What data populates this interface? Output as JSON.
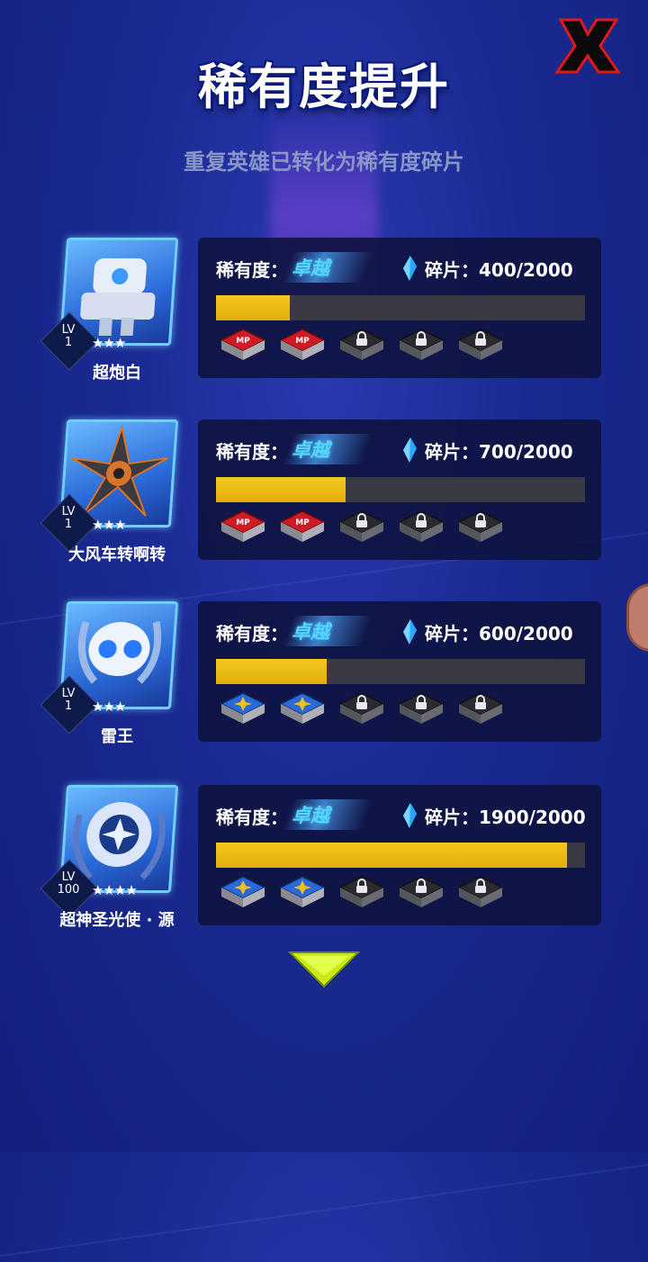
{
  "title": "稀有度提升",
  "subtitle": "重复英雄已转化为稀有度碎片",
  "rarity_label": "稀有度：",
  "shard_label": "碎片：",
  "heroes": [
    {
      "name": "超炮白",
      "lv_label": "LV",
      "lv": "1",
      "stars": "★★★",
      "rarity": "卓越",
      "shards": "400/2000",
      "progress": 0.2,
      "portrait_icon": "white-robot-icon",
      "slots": [
        "mp-chip-icon",
        "mp-chip-icon",
        "lock-icon",
        "lock-icon",
        "lock-icon"
      ]
    },
    {
      "name": "大风车转啊转",
      "lv_label": "LV",
      "lv": "1",
      "stars": "★★★",
      "rarity": "卓越",
      "shards": "700/2000",
      "progress": 0.35,
      "portrait_icon": "shuriken-robot-icon",
      "slots": [
        "mp-chip-icon",
        "mp-chip-icon",
        "lock-icon",
        "lock-icon",
        "lock-icon"
      ]
    },
    {
      "name": "雷王",
      "lv_label": "LV",
      "lv": "1",
      "stars": "★★★",
      "rarity": "卓越",
      "shards": "600/2000",
      "progress": 0.3,
      "portrait_icon": "thunder-robot-icon",
      "slots": [
        "star-chip-icon",
        "star-chip-icon",
        "lock-icon",
        "lock-icon",
        "lock-icon"
      ]
    },
    {
      "name": "超神圣光使 · 源",
      "lv_label": "LV",
      "lv": "100",
      "stars": "★★★★",
      "rarity": "卓越",
      "shards": "1900/2000",
      "progress": 0.95,
      "portrait_icon": "holy-robot-icon",
      "slots": [
        "star-chip-icon",
        "star-chip-icon",
        "lock-icon",
        "lock-icon",
        "lock-icon"
      ]
    }
  ],
  "colors": {
    "background": "#1a2a92",
    "bar_fill": "#e9b814",
    "rarity_text": "#55d8ff",
    "close_x": "#d01010"
  }
}
